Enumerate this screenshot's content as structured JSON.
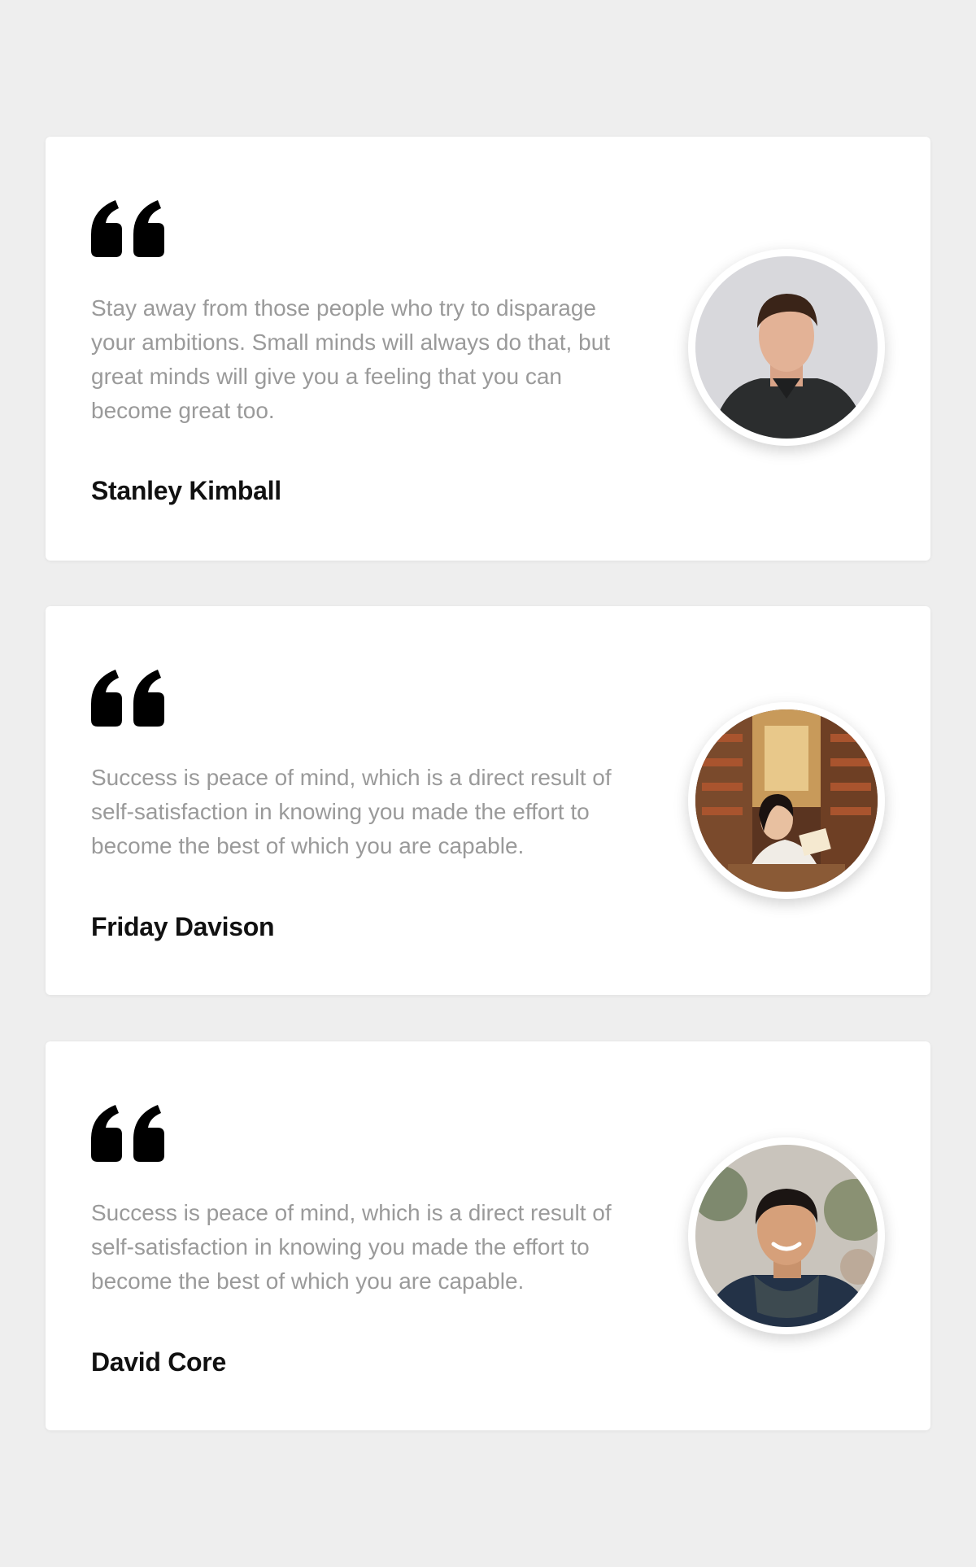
{
  "testimonials": [
    {
      "quote": "Stay away from those people who try to disparage your ambitions. Small minds will always do that, but great minds will give you a feeling that you can become great too.",
      "author": "Stanley Kimball",
      "avatar": "portrait-man-gray-background"
    },
    {
      "quote": "Success is peace of mind, which is a direct result of self-satisfaction in knowing you made the effort to become the best of which you are capable.",
      "author": "Friday Davison",
      "avatar": "portrait-woman-bookstore"
    },
    {
      "quote": "Success is peace of mind, which is a direct result of self-satisfaction in knowing you made the effort to become the best of which you are capable.",
      "author": "David Core",
      "avatar": "portrait-man-smiling-scarf"
    }
  ],
  "colors": {
    "page_background": "#eeeeee",
    "card_background": "#ffffff",
    "quote_text": "#9a9a9a",
    "author_text": "#111111",
    "quote_icon": "#000000"
  }
}
